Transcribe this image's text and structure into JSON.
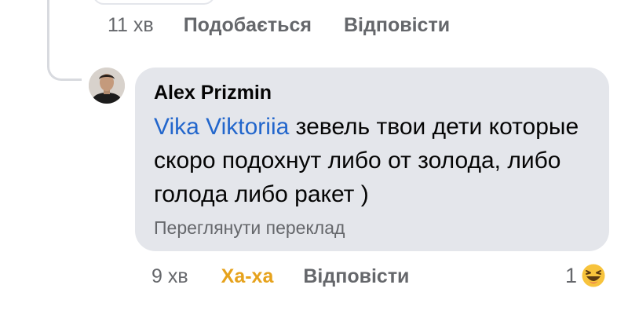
{
  "previous_comment": {
    "time": "11 хв",
    "like_label": "Подобається",
    "reply_label": "Відповісти"
  },
  "reply": {
    "author": "Alex Prizmin",
    "mention": "Vika Viktoriia",
    "text": " зевель твои дети которые скоро подохнут либо от золода, либо голода либо ракет )",
    "translate_label": "Переглянути переклад",
    "time": "9 хв",
    "reaction_label": "Ха-ха",
    "reply_label": "Відповісти",
    "reaction_count": "1",
    "reaction_icon": "haha-emoji-icon"
  },
  "colors": {
    "bubble": "#e4e6eb",
    "mention": "#2266cc",
    "haha": "#e6a21c",
    "meta": "#65676b"
  }
}
